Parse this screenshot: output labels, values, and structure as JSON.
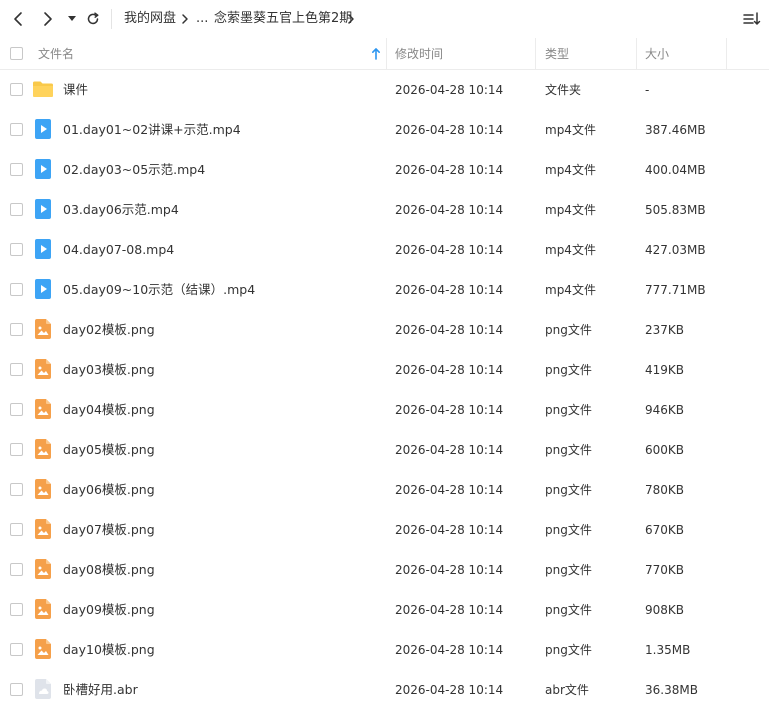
{
  "breadcrumb": {
    "root": "我的网盘",
    "ellipsis": "...",
    "current": "念萦墨葵五官上色第2期"
  },
  "columns": {
    "name": "文件名",
    "modified": "修改时间",
    "type": "类型",
    "size": "大小"
  },
  "colors": {
    "folder": "#f9c94a",
    "video": "#3da4f5",
    "image": "#f5a04a",
    "abr": "#dfe3ea",
    "sort_arrow": "#2b95f0"
  },
  "rows": [
    {
      "name": "课件",
      "time": "2026-04-28 10:14",
      "type": "文件夹",
      "size": "-",
      "icon": "folder-icon"
    },
    {
      "name": "01.day01~02讲课+示范.mp4",
      "time": "2026-04-28 10:14",
      "type": "mp4文件",
      "size": "387.46MB",
      "icon": "video-file-icon"
    },
    {
      "name": "02.day03~05示范.mp4",
      "time": "2026-04-28 10:14",
      "type": "mp4文件",
      "size": "400.04MB",
      "icon": "video-file-icon"
    },
    {
      "name": "03.day06示范.mp4",
      "time": "2026-04-28 10:14",
      "type": "mp4文件",
      "size": "505.83MB",
      "icon": "video-file-icon"
    },
    {
      "name": "04.day07-08.mp4",
      "time": "2026-04-28 10:14",
      "type": "mp4文件",
      "size": "427.03MB",
      "icon": "video-file-icon"
    },
    {
      "name": "05.day09~10示范（结课）.mp4",
      "time": "2026-04-28 10:14",
      "type": "mp4文件",
      "size": "777.71MB",
      "icon": "video-file-icon"
    },
    {
      "name": "day02模板.png",
      "time": "2026-04-28 10:14",
      "type": "png文件",
      "size": "237KB",
      "icon": "image-file-icon"
    },
    {
      "name": "day03模板.png",
      "time": "2026-04-28 10:14",
      "type": "png文件",
      "size": "419KB",
      "icon": "image-file-icon"
    },
    {
      "name": "day04模板.png",
      "time": "2026-04-28 10:14",
      "type": "png文件",
      "size": "946KB",
      "icon": "image-file-icon"
    },
    {
      "name": "day05模板.png",
      "time": "2026-04-28 10:14",
      "type": "png文件",
      "size": "600KB",
      "icon": "image-file-icon"
    },
    {
      "name": "day06模板.png",
      "time": "2026-04-28 10:14",
      "type": "png文件",
      "size": "780KB",
      "icon": "image-file-icon"
    },
    {
      "name": "day07模板.png",
      "time": "2026-04-28 10:14",
      "type": "png文件",
      "size": "670KB",
      "icon": "image-file-icon"
    },
    {
      "name": "day08模板.png",
      "time": "2026-04-28 10:14",
      "type": "png文件",
      "size": "770KB",
      "icon": "image-file-icon"
    },
    {
      "name": "day09模板.png",
      "time": "2026-04-28 10:14",
      "type": "png文件",
      "size": "908KB",
      "icon": "image-file-icon"
    },
    {
      "name": "day10模板.png",
      "time": "2026-04-28 10:14",
      "type": "png文件",
      "size": "1.35MB",
      "icon": "image-file-icon"
    },
    {
      "name": "卧槽好用.abr",
      "time": "2026-04-28 10:14",
      "type": "abr文件",
      "size": "36.38MB",
      "icon": "generic-file-icon"
    }
  ]
}
